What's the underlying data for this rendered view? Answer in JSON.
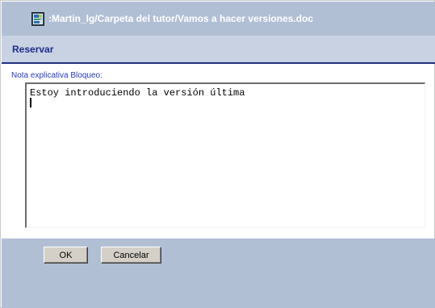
{
  "window": {
    "title": ":Martin_lg/Carpeta del tutor/Vamos a hacer versiones.doc",
    "icon": "document-icon"
  },
  "section": {
    "title": "Reservar"
  },
  "note": {
    "label": "Nota explicativa Bloqueo:",
    "value": "Estoy introduciendo la versión última"
  },
  "buttons": {
    "ok_label": "OK",
    "cancel_label": "Cancelar"
  },
  "colors": {
    "title_bar": "#b1bfd5",
    "title_text": "#ffffff",
    "section_bar": "#c9d2e3",
    "section_title": "#1a2d8c",
    "section_rule": "#22317f",
    "label_text": "#2639c9",
    "button_face": "#d4d0c8"
  }
}
